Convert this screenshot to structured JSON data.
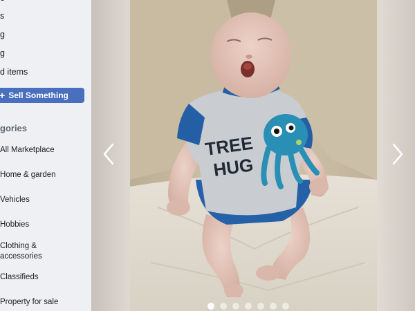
{
  "sidebar": {
    "nav": [
      {
        "label": "e"
      },
      {
        "label": "s"
      },
      {
        "label": "g"
      },
      {
        "label": "g"
      },
      {
        "label": "d items"
      }
    ],
    "sell_button": "Sell Something",
    "categories_heading": "gories",
    "categories": [
      {
        "label": "All Marketplace"
      },
      {
        "label": "Home & garden"
      },
      {
        "label": "Vehicles"
      },
      {
        "label": "Hobbies"
      },
      {
        "label": "Clothing &\naccessories"
      },
      {
        "label": "Classifieds"
      },
      {
        "label": "Property for sale"
      }
    ]
  },
  "viewer": {
    "image_subject": "reborn-baby-doll-photo",
    "prev_icon": "chevron-left-icon",
    "next_icon": "chevron-right-icon",
    "dot_count": 7,
    "active_dot": 1
  },
  "colors": {
    "accent": "#4a6fbf",
    "sidebar_bg": "#eef0f3"
  }
}
